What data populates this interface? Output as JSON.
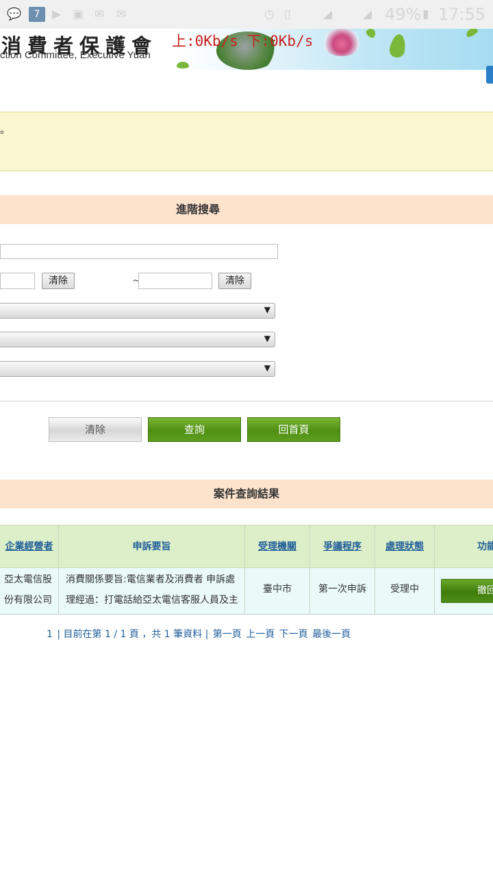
{
  "status_bar": {
    "notification_badge": "7",
    "battery_percent": "49%",
    "time": "17:55",
    "icons": [
      "chat-icon",
      "photo-icon",
      "camera-icon",
      "gallery-icon",
      "mail-icon",
      "mail-icon",
      "alarm-icon",
      "vibrate-icon",
      "data-icon",
      "signal-icon",
      "battery-icon"
    ]
  },
  "banner": {
    "title_zh": "消費者保護會",
    "subtitle_en": "ction Committee, Executive Yuan",
    "network_speed": "上:0Kb/s  下:0Kb/s"
  },
  "notice": {
    "text": "。"
  },
  "search": {
    "header": "進階搜尋",
    "clear_label_1": "清除",
    "tilde": "~",
    "clear_label_2": "清除",
    "select_arrow": "▼"
  },
  "actions": {
    "clear": "清除",
    "query": "查詢",
    "home": "回首頁"
  },
  "results": {
    "header": "案件查詢結果",
    "columns": [
      "企業經營者",
      "申訴要旨",
      "受理機關",
      "爭議程序",
      "處理狀態",
      "功能"
    ],
    "rows": [
      {
        "company_line1": "亞太電信股",
        "company_line2": "份有限公司",
        "summary_line1": "消費關係要旨:電信業者及消費者 申訴處",
        "summary_line2": "理經過：打電話給亞太電信客服人員及主",
        "agency": "臺中市",
        "procedure": "第一次申訴",
        "status": "受理中",
        "action": "撤回"
      }
    ]
  },
  "pager": {
    "page_link": "1",
    "info": "| 目前在第 1 / 1 頁 ，共 1 筆資料 |",
    "first": "第一頁",
    "prev": "上一頁",
    "next": "下一頁",
    "last": "最後一頁"
  },
  "colors": {
    "section_header_bg": "#fde2cc",
    "notice_bg": "#fbf7d2",
    "table_header_bg": "#ddefc8",
    "table_row_bg": "#eafaf8",
    "green_button": "#4f8f12",
    "link": "#1f5e9a",
    "speed_text": "#c8201e"
  }
}
